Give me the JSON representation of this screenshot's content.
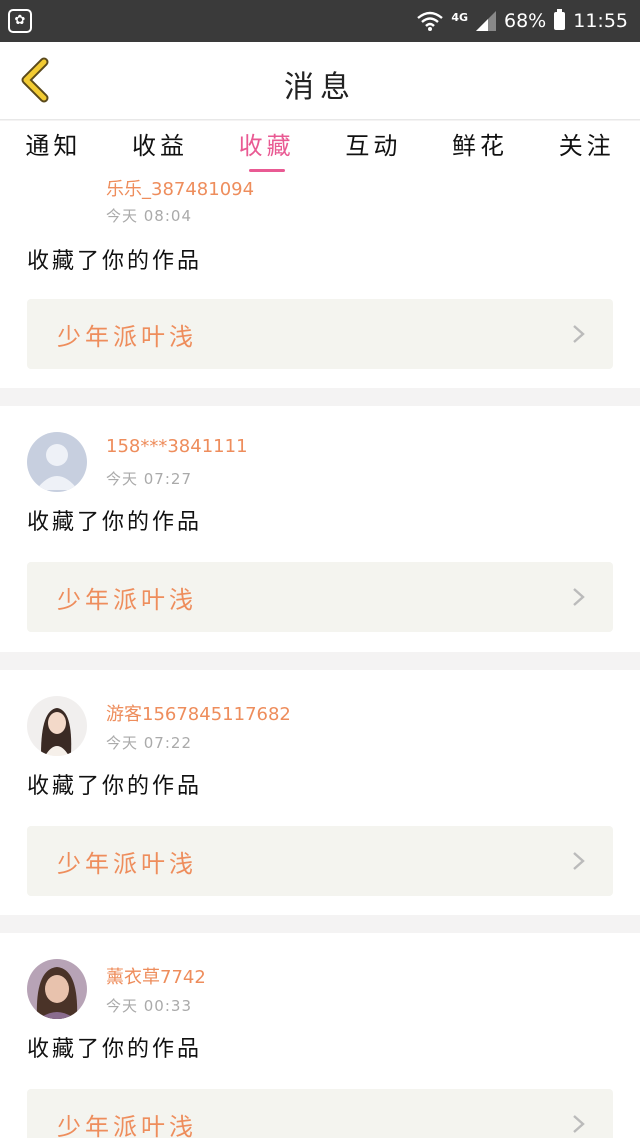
{
  "status_bar": {
    "app_icon": "paw-icon",
    "network": "4G",
    "battery": "68%",
    "time": "11:55"
  },
  "header": {
    "title": "消息",
    "back_icon": "chevron-left-icon"
  },
  "tabs": [
    {
      "label": "通知"
    },
    {
      "label": "收益"
    },
    {
      "label": "收藏",
      "active": true
    },
    {
      "label": "互动"
    },
    {
      "label": "鲜花"
    },
    {
      "label": "关注"
    }
  ],
  "accent_color": "#e95a93",
  "messages": [
    {
      "user": "乐乐_387481094",
      "time": "今天 08:04",
      "action": "收藏了你的作品",
      "work_title": "少年派叶浅"
    },
    {
      "user": "158***3841111",
      "time": "今天 07:27",
      "action": "收藏了你的作品",
      "work_title": "少年派叶浅"
    },
    {
      "user": "游客1567845117682",
      "time": "今天 07:22",
      "action": "收藏了你的作品",
      "work_title": "少年派叶浅"
    },
    {
      "user": "薰衣草7742",
      "time": "今天 00:33",
      "action": "收藏了你的作品",
      "work_title": "少年派叶浅"
    }
  ]
}
